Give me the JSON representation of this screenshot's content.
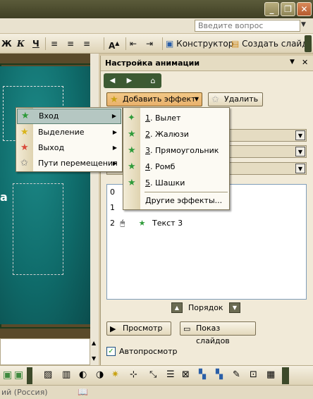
{
  "window": {
    "minimize": "_",
    "restore": "❐",
    "close": "✕"
  },
  "menubar": {
    "help_placeholder": "Введите вопрос",
    "help_arrow": "▼"
  },
  "toolbar": {
    "bold": "Ж",
    "italic": "К",
    "underline": "Ч",
    "designer_label": "Конструктор",
    "new_slide_label": "Создать слайд"
  },
  "slide": {
    "visible_fragment": "a"
  },
  "task_pane": {
    "title": "Настройка анимации",
    "close_glyph": "✕",
    "dropdown_glyph": "▼",
    "add_effect_label": "Добавить эффект",
    "remove_label": "Удалить",
    "order_label": "Порядок",
    "preview_label": "Просмотр",
    "slideshow_label": "Показ слайдов",
    "autopreview_label": "Автопросмотр",
    "animation_items": [
      {
        "num": "0",
        "name": ""
      },
      {
        "num": "1",
        "name": ""
      },
      {
        "num": "2",
        "name": "Текст 3"
      }
    ]
  },
  "effect_menu": {
    "items": [
      {
        "label": "Вход",
        "icon": "entrance-star-icon"
      },
      {
        "label": "Выделение",
        "icon": "emphasis-star-icon"
      },
      {
        "label": "Выход",
        "icon": "exit-star-icon"
      },
      {
        "label": "Пути перемещения",
        "icon": "motion-path-star-icon"
      }
    ]
  },
  "entrance_submenu": {
    "items": [
      {
        "num": "1",
        "label": "Вылет"
      },
      {
        "num": "2",
        "label": "Жалюзи"
      },
      {
        "num": "3",
        "label": "Прямоугольник"
      },
      {
        "num": "4",
        "label": "Ромб"
      },
      {
        "num": "5",
        "label": "Шашки"
      }
    ],
    "more_label": "Другие эффекты..."
  },
  "status": {
    "language": "ий (Россия)"
  },
  "colors": {
    "slide_teal": "#0f6b6a",
    "title_bar": "#4b4b2f",
    "highlight": "#c1d2ee",
    "star_green": "#2e9b3a"
  }
}
